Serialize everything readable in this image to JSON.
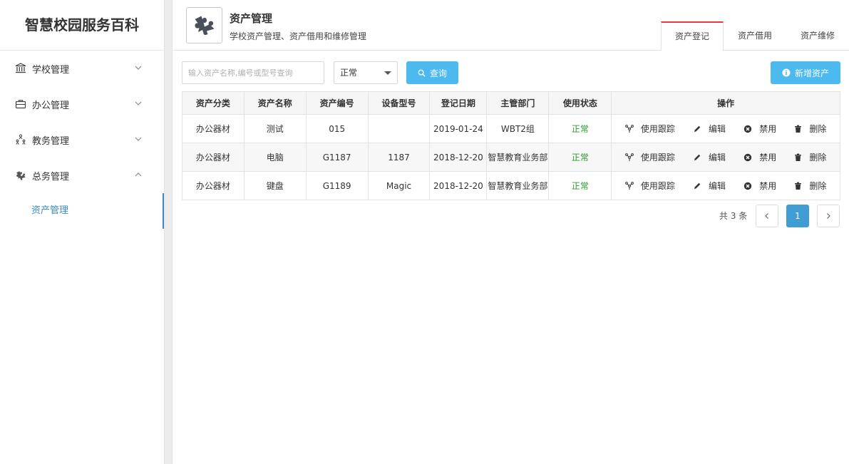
{
  "app": {
    "title": "智慧校园服务百科"
  },
  "sidebar": {
    "items": [
      {
        "label": "学校管理",
        "icon": "bank-icon",
        "expanded": false
      },
      {
        "label": "办公管理",
        "icon": "briefcase-icon",
        "expanded": false
      },
      {
        "label": "教务管理",
        "icon": "people-tree-icon",
        "expanded": false
      },
      {
        "label": "总务管理",
        "icon": "puzzle-icon",
        "expanded": true,
        "children": [
          {
            "label": "资产管理",
            "active": true
          }
        ]
      }
    ]
  },
  "header": {
    "icon": "puzzle-icon",
    "title": "资产管理",
    "subtitle": "学校资产管理、资产借用和维修管理",
    "tabs": [
      {
        "label": "资产登记",
        "active": true
      },
      {
        "label": "资产借用",
        "active": false
      },
      {
        "label": "资产维修",
        "active": false
      }
    ]
  },
  "toolbar": {
    "search_placeholder": "输入资产名称,编号或型号查询",
    "search_value": "",
    "status_selected": "正常",
    "query_label": "查询",
    "add_label": "新增资产"
  },
  "table": {
    "columns": [
      "资产分类",
      "资产名称",
      "资产编号",
      "设备型号",
      "登记日期",
      "主管部门",
      "使用状态",
      "操作"
    ],
    "rows": [
      {
        "category": "办公器材",
        "name": "测试",
        "code": "015",
        "model": "",
        "date": "2019-01-24",
        "dept": "WBT2组",
        "status": "正常"
      },
      {
        "category": "办公器材",
        "name": "电脑",
        "code": "G1187",
        "model": "1187",
        "date": "2018-12-20",
        "dept": "智慧教育业务部",
        "status": "正常"
      },
      {
        "category": "办公器材",
        "name": "键盘",
        "code": "G1189",
        "model": "Magic",
        "date": "2018-12-20",
        "dept": "智慧教育业务部",
        "status": "正常"
      }
    ],
    "actions": [
      "使用跟踪",
      "编辑",
      "禁用",
      "删除"
    ],
    "status_color": "#2e9a2e"
  },
  "pagination": {
    "total_text": "共 3 条",
    "current": "1"
  },
  "colors": {
    "accent": "#4cb9ef",
    "active_tab_border": "#e63a3a",
    "sidebar_active": "#3a8dc5",
    "page_current": "#3f9dd4"
  }
}
